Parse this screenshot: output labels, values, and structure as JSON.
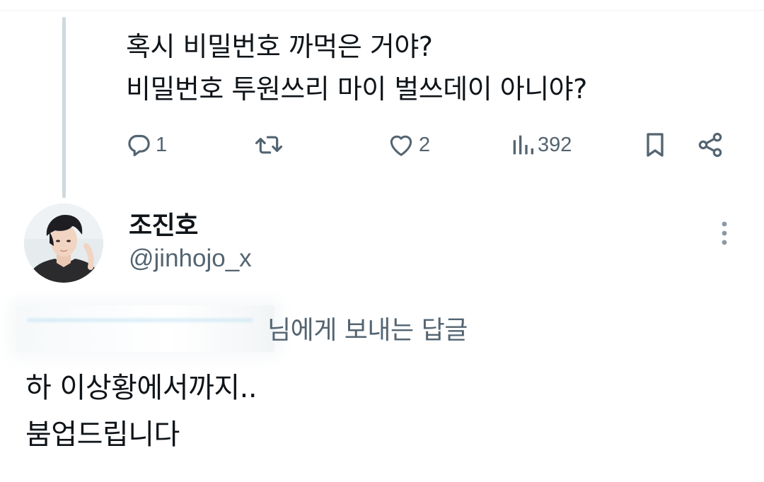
{
  "parent_tweet": {
    "lines": [
      "혹시 비밀번호 까먹은 거야?",
      "비밀번호 투원쓰리 마이 벌쓰데이 아니야?"
    ],
    "actions": {
      "reply_icon": "comment-icon",
      "reply_count": "1",
      "retweet_icon": "retweet-icon",
      "like_icon": "heart-icon",
      "like_count": "2",
      "views_icon": "bar-chart-icon",
      "views_count": "392",
      "bookmark_icon": "bookmark-icon",
      "share_icon": "share-icon"
    }
  },
  "reply_tweet": {
    "author": {
      "display_name": "조진호",
      "handle": "@jinhojo_x"
    },
    "more_icon": "vertical-ellipsis-icon",
    "replying_to_suffix": "님에게 보내는 답글",
    "lines": [
      "하 이상황에서까지..",
      "붐업드립니다"
    ]
  },
  "colors": {
    "text_primary": "#0f1419",
    "text_secondary": "#536471",
    "thread_line": "#cfd9de"
  }
}
